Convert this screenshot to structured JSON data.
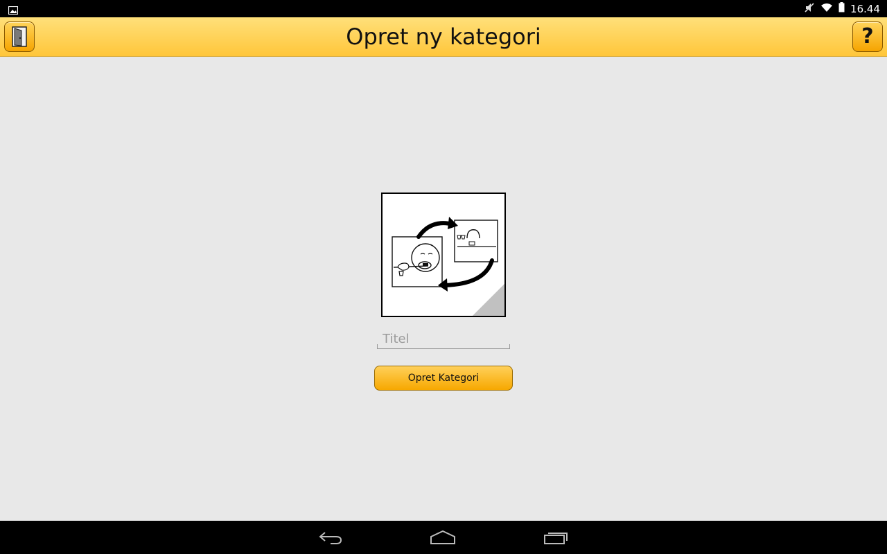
{
  "status_bar": {
    "time": "16.44",
    "icons": [
      "image-notification-icon",
      "mute-icon",
      "wifi-icon",
      "battery-icon"
    ]
  },
  "action_bar": {
    "title": "Opret ny kategori",
    "left_button": "exit-door-icon",
    "right_button_label": "?"
  },
  "form": {
    "image_icon": "pictogram-brush-teeth-cycle",
    "title_placeholder": "Titel",
    "title_value": "",
    "create_button_label": "Opret Kategori"
  },
  "nav_bar": {
    "buttons": [
      "back-icon",
      "home-icon",
      "recent-apps-icon"
    ]
  },
  "colors": {
    "accent_top": "#ffe07a",
    "accent_bottom": "#f6a400",
    "background": "#e8e8e8"
  }
}
